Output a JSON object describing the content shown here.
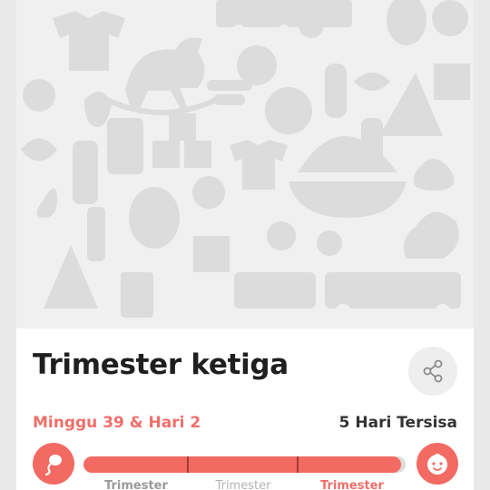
{
  "card": {
    "title": "Trimester ketiga",
    "progress_text": "Minggu 39 & Hari 2",
    "remaining_text": "5 Hari Tersisa",
    "progress_fraction": 0.985
  },
  "trimesters": [
    {
      "label": "Trimester"
    },
    {
      "label": "Trimester"
    },
    {
      "label": "Trimester"
    }
  ],
  "icons": {
    "share": "share-icon",
    "fetus": "sperm-icon",
    "baby": "baby-face-icon"
  },
  "colors": {
    "accent": "#f26a62",
    "accent_text": "#ef6f6a",
    "divider": "#a23b35",
    "track": "#dcdcdc"
  }
}
